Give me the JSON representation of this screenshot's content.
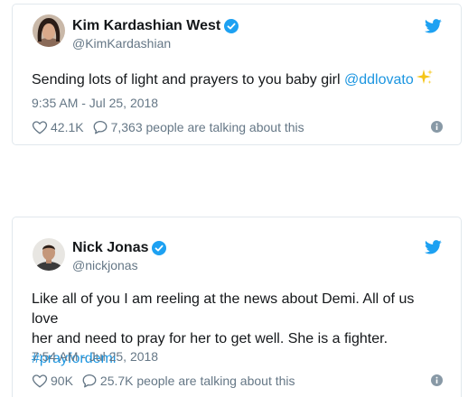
{
  "tweets": [
    {
      "author_name": "Kim Kardashian West",
      "handle": "@KimKardashian",
      "text_before": "Sending lots of light and prayers to you baby girl ",
      "mention": "@ddlovato",
      "timestamp": "9:35 AM - Jul 25, 2018",
      "likes": "42.1K",
      "talking": "7,363 people are talking about this",
      "emoji": "sparkles-emoji"
    },
    {
      "author_name": "Nick Jonas",
      "handle": "@nickjonas",
      "text_line1": "Like all of you I am reeling at the news about Demi. All of us love",
      "text_line2": "her and need to pray for her to get well. She is a fighter.",
      "hashtag": "#prayfordemi",
      "timestamp": "7:54 AM - Jul 25, 2018",
      "likes": "90K",
      "talking": "25.7K people are talking about this"
    }
  ],
  "colors": {
    "twitter_blue": "#1da1f2",
    "link": "#1b95e0",
    "secondary_text": "#657786",
    "border": "#e1e8ed"
  },
  "icons": [
    "twitter-bird-icon",
    "verified-badge-icon",
    "heart-icon",
    "reply-bubble-icon",
    "info-icon"
  ]
}
